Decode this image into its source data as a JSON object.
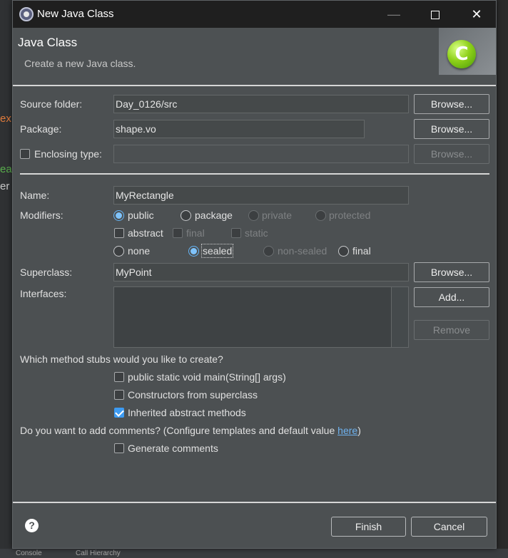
{
  "window": {
    "title": "New Java Class",
    "controls": {
      "minimize": "—",
      "maximize": "□",
      "close": "✕"
    }
  },
  "header": {
    "title": "Java Class",
    "subtitle": "Create a new Java class.",
    "logo_letter": "C",
    "logo_icon": "java-class-icon"
  },
  "form": {
    "source_folder": {
      "label": "Source folder:",
      "value": "Day_0126/src",
      "button": "Browse..."
    },
    "package": {
      "label": "Package:",
      "value": "shape.vo",
      "button": "Browse..."
    },
    "enclosing_type": {
      "label": "Enclosing type:",
      "value": "",
      "checked": false,
      "button": "Browse..."
    },
    "name": {
      "label": "Name:",
      "value": "MyRectangle"
    },
    "modifiers": {
      "label": "Modifiers:",
      "access": [
        {
          "label": "public",
          "checked": true,
          "enabled": true
        },
        {
          "label": "package",
          "checked": false,
          "enabled": true
        },
        {
          "label": "private",
          "checked": false,
          "enabled": false
        },
        {
          "label": "protected",
          "checked": false,
          "enabled": false
        }
      ],
      "flags": [
        {
          "label": "abstract",
          "checked": false,
          "enabled": true
        },
        {
          "label": "final",
          "checked": false,
          "enabled": false
        },
        {
          "label": "static",
          "checked": false,
          "enabled": false
        }
      ],
      "sealing": [
        {
          "label": "none",
          "checked": false,
          "enabled": true
        },
        {
          "label": "sealed",
          "checked": true,
          "enabled": true
        },
        {
          "label": "non-sealed",
          "checked": false,
          "enabled": false
        },
        {
          "label": "final",
          "checked": false,
          "enabled": true
        }
      ]
    },
    "superclass": {
      "label": "Superclass:",
      "value": "MyPoint",
      "button": "Browse..."
    },
    "interfaces": {
      "label": "Interfaces:",
      "add_button": "Add...",
      "remove_button": "Remove",
      "items": []
    },
    "stubs": {
      "question": "Which method stubs would you like to create?",
      "options": [
        {
          "label": "public static void main(String[] args)",
          "checked": false
        },
        {
          "label": "Constructors from superclass",
          "checked": false
        },
        {
          "label": "Inherited abstract methods",
          "checked": true
        }
      ]
    },
    "comments": {
      "question_prefix": "Do you want to add comments? (Configure templates and default value ",
      "link": "here",
      "question_suffix": ")",
      "option": {
        "label": "Generate comments",
        "checked": false
      }
    }
  },
  "footer": {
    "help_icon": "help-icon",
    "help_glyph": "?",
    "finish": "Finish",
    "cancel": "Cancel"
  },
  "background": {
    "fragments": [
      "ex",
      "ea",
      "er"
    ],
    "bottom_tabs": [
      "Console",
      "Call Hierarchy"
    ]
  }
}
